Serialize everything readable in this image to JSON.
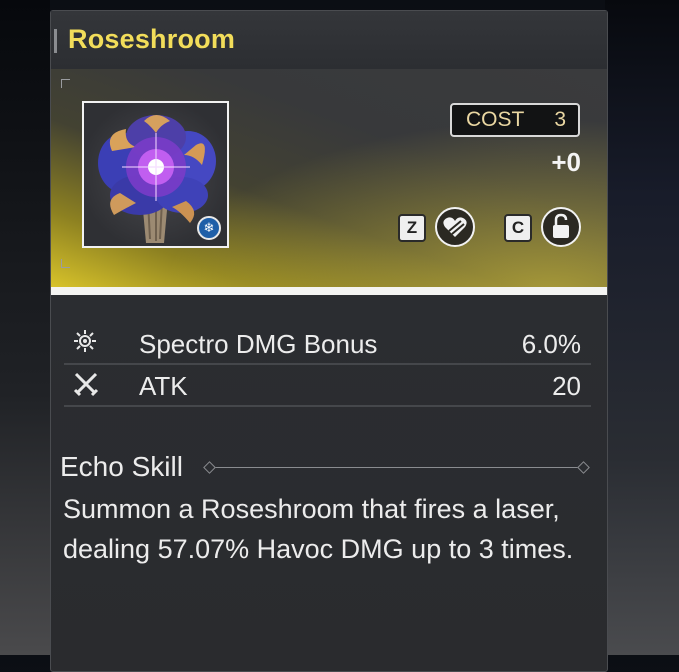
{
  "echo": {
    "name": "Roseshroom",
    "cost_label": "COST",
    "cost_value": "3",
    "level": "+0",
    "element_icon": "snowflake-icon",
    "accent_color": "#f2dd5a"
  },
  "actions": {
    "favorite_key": "Z",
    "lock_key": "C"
  },
  "stats": [
    {
      "name": "Spectro DMG Bonus",
      "value": "6.0%",
      "icon": "spectro-icon"
    },
    {
      "name": "ATK",
      "value": "20",
      "icon": "atk-swords-icon"
    }
  ],
  "skill": {
    "title": "Echo Skill",
    "description": "Summon a Roseshroom that fires a laser, dealing 57.07% Havoc DMG up to 3 times."
  }
}
